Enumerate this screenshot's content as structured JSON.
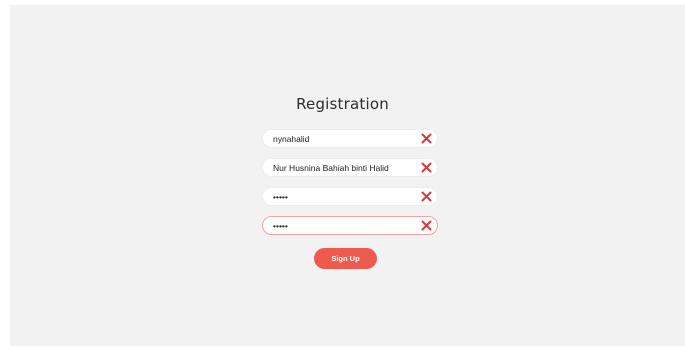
{
  "form": {
    "title": "Registration",
    "fields": [
      {
        "name": "username",
        "type": "text",
        "value": "nynahalid",
        "placeholder": ""
      },
      {
        "name": "fullname",
        "type": "text",
        "value": "Nur Husnina Bahiah binti Halid",
        "placeholder": ""
      },
      {
        "name": "password",
        "type": "password",
        "value": "•••••",
        "placeholder": ""
      },
      {
        "name": "confirm_password",
        "type": "password",
        "value": "•••••",
        "placeholder": ""
      }
    ],
    "clear_icon": "close-icon",
    "submit_label": "Sign Up"
  },
  "colors": {
    "background": "#f2f2f2",
    "accent": "#ee5a4d",
    "clear_icon": "#d33b3b",
    "active_border": "#f0a39e"
  }
}
